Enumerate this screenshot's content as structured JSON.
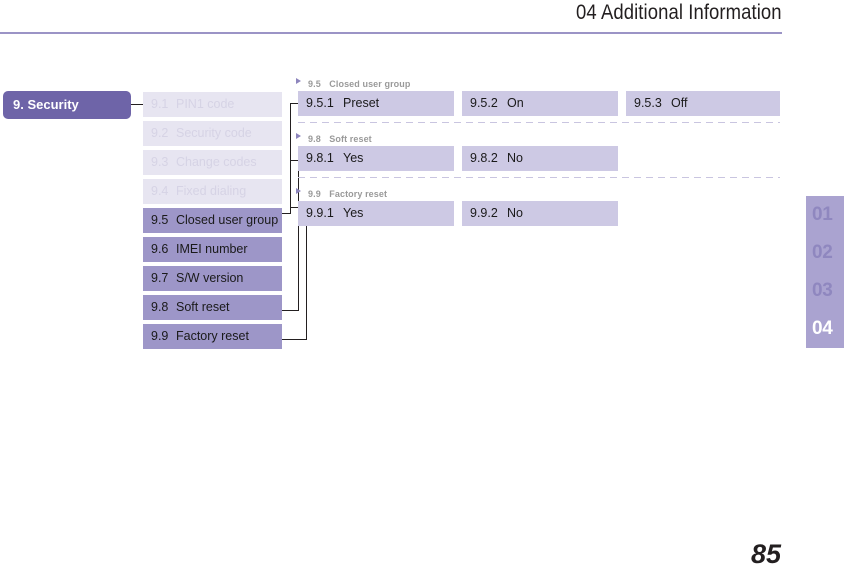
{
  "header": {
    "title": "04 Additional Information",
    "rule_color": "#9b94c6"
  },
  "root_node": {
    "label": "9. Security",
    "background": "#6e64a8",
    "text_color": "#ffffff"
  },
  "sidebar": {
    "items": [
      {
        "num": "9.1",
        "label": "PIN1 code",
        "state": "dim"
      },
      {
        "num": "9.2",
        "label": "Security code",
        "state": "dim"
      },
      {
        "num": "9.3",
        "label": "Change codes",
        "state": "dim"
      },
      {
        "num": "9.4",
        "label": "Fixed dialing",
        "state": "dim"
      },
      {
        "num": "9.5",
        "label": "Closed user group",
        "state": "active"
      },
      {
        "num": "9.6",
        "label": "IMEI number",
        "state": "active"
      },
      {
        "num": "9.7",
        "label": "S/W version",
        "state": "active"
      },
      {
        "num": "9.8",
        "label": "Soft reset",
        "state": "active"
      },
      {
        "num": "9.9",
        "label": "Factory reset",
        "state": "active"
      }
    ],
    "dim_background": "#e7e5f1",
    "active_background": "#9d96c8"
  },
  "detail_groups": [
    {
      "head_num": "9.5",
      "head_label": "Closed user group",
      "options": [
        {
          "num": "9.5.1",
          "label": "Preset"
        },
        {
          "num": "9.5.2",
          "label": "On"
        },
        {
          "num": "9.5.3",
          "label": "Off"
        }
      ]
    },
    {
      "head_num": "9.8",
      "head_label": "Soft reset",
      "options": [
        {
          "num": "9.8.1",
          "label": "Yes"
        },
        {
          "num": "9.8.2",
          "label": "No"
        }
      ]
    },
    {
      "head_num": "9.9",
      "head_label": "Factory reset",
      "options": [
        {
          "num": "9.9.1",
          "label": "Yes"
        },
        {
          "num": "9.9.2",
          "label": "No"
        }
      ]
    }
  ],
  "chapter_tabs": {
    "items": [
      {
        "label": "01",
        "state": "inactive"
      },
      {
        "label": "02",
        "state": "inactive"
      },
      {
        "label": "03",
        "state": "inactive"
      },
      {
        "label": "04",
        "state": "current"
      }
    ],
    "strip_background": "#aaa3d0"
  },
  "page_number": "85"
}
